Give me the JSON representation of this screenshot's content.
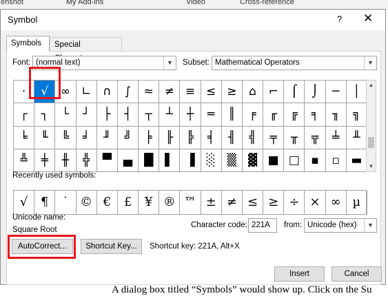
{
  "background": {
    "top_left": "enshot",
    "top_tab_1": "My Add-ins",
    "top_tab_2": "Video",
    "top_tab_3": "Cross-reference",
    "bottom_sentence": "A dialog box titled “Symbols” would show up. Click on the Su"
  },
  "dialog": {
    "title": "Symbol",
    "help": "?",
    "close": "✕"
  },
  "tabs": [
    {
      "label": "Symbols",
      "active": true
    },
    {
      "label": "Special Characters",
      "active": false
    }
  ],
  "font": {
    "label": "Font:",
    "value": "(normal text)"
  },
  "subset": {
    "label": "Subset:",
    "value": "Mathematical Operators"
  },
  "symbol_grid": [
    [
      "·",
      "√",
      "∞",
      "∟",
      "∩",
      "∫",
      "≈",
      "≠",
      "≡",
      "≤",
      "≥",
      "⌂",
      "⌐",
      "⌠",
      "⌡",
      "─",
      "│"
    ],
    [
      "┌",
      "┐",
      "└",
      "┘",
      "├",
      "┤",
      "┬",
      "┴",
      "┼",
      "═",
      "║",
      "╒",
      "╓",
      "╔",
      "╕",
      "╖",
      "╗"
    ],
    [
      "╘",
      "╙",
      "╚",
      "╛",
      "╜",
      "╝",
      "╞",
      "╟",
      "╠",
      "╡",
      "╢",
      "╣",
      "╤",
      "╥",
      "╦",
      "╧",
      "╨"
    ],
    [
      "╩",
      "╪",
      "╫",
      "╬",
      "▀",
      "▄",
      "█",
      "▌",
      "▐",
      "░",
      "▒",
      "▓",
      "■",
      "□",
      "▪",
      "▫",
      "▬"
    ]
  ],
  "selected_symbol": "√",
  "recent": {
    "label": "Recently used symbols:",
    "symbols": [
      "√",
      "¶",
      "˙",
      "©",
      "€",
      "£",
      "¥",
      "®",
      "™",
      "±",
      "≠",
      "≤",
      "≥",
      "÷",
      "×",
      "∞",
      "µ"
    ]
  },
  "unicode": {
    "label": "Unicode name:",
    "name": "Square Root"
  },
  "char_code": {
    "label": "Character code:",
    "value": "221A"
  },
  "from": {
    "label": "from:",
    "value": "Unicode (hex)"
  },
  "buttons": {
    "autocorrect": "AutoCorrect...",
    "shortcut_key": "Shortcut Key...",
    "shortcut_text": "Shortcut key: 221A, Alt+X",
    "insert": "Insert",
    "cancel": "Cancel"
  },
  "highlight_color": "#e8141c",
  "selection_color": "#0078d7"
}
